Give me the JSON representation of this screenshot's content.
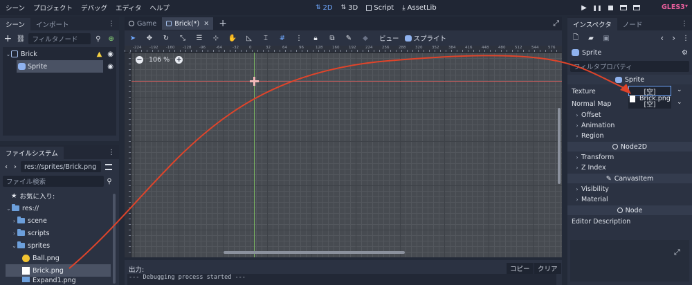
{
  "menubar": {
    "menus": [
      "シーン",
      "プロジェクト",
      "デバッグ",
      "エディタ",
      "ヘルプ"
    ],
    "workspaces": [
      {
        "label": "2D",
        "icon": "2d-icon",
        "active": true
      },
      {
        "label": "3D",
        "icon": "3d-icon",
        "active": false
      },
      {
        "label": "Script",
        "icon": "script-icon",
        "active": false
      },
      {
        "label": "AssetLib",
        "icon": "assetlib-icon",
        "active": false
      }
    ],
    "renderer": "GLES3"
  },
  "scene_dock": {
    "tabs": [
      "シーン",
      "インポート"
    ],
    "filter_placeholder": "フィルタノード",
    "nodes": [
      {
        "label": "Brick",
        "icon": "node2d-icon",
        "warning": true
      },
      {
        "label": "Sprite",
        "icon": "sprite-icon",
        "selected": true
      }
    ]
  },
  "filesystem": {
    "tab": "ファイルシステム",
    "path": "res://sprites/Brick.png",
    "search_placeholder": "ファイル検索",
    "favorites": "お気に入り:",
    "root": "res://",
    "folders": [
      "scene",
      "scripts",
      "sprites"
    ],
    "files": [
      {
        "label": "Ball.png",
        "selected": false
      },
      {
        "label": "Brick.png",
        "selected": true
      },
      {
        "label": "Expand1.png",
        "selected": false
      }
    ]
  },
  "editor_tabs": {
    "tabs": [
      {
        "label": "Game",
        "active": false
      },
      {
        "label": "Brick(*)",
        "active": true
      }
    ]
  },
  "canvas_toolbar": {
    "view_label": "ビュー",
    "sprite_label": "スプライト",
    "zoom": "106 %"
  },
  "ruler": {
    "labels": [
      "-224",
      "-192",
      "-160",
      "-128",
      "-96",
      "-64",
      "-32",
      "0",
      "32",
      "64",
      "96",
      "128",
      "160",
      "192",
      "224",
      "256",
      "288",
      "320",
      "352",
      "384",
      "416",
      "448",
      "480",
      "512",
      "544",
      "576"
    ]
  },
  "output": {
    "title": "出力:",
    "copy_label": "コピー",
    "clear_label": "クリア",
    "lines": [
      "--- Debugging process started ---"
    ]
  },
  "inspector": {
    "tabs": [
      "インスペクタ",
      "ノード"
    ],
    "node_name": "Sprite",
    "filter_placeholder": "フィルタプロパティ",
    "sprite_section": "Sprite",
    "texture_label": "Texture",
    "texture_value": "[空]",
    "normalmap_label": "Normal Map",
    "normalmap_value": "[空]",
    "drag_preview": "Brick.png",
    "sprite_groups": [
      "Offset",
      "Animation",
      "Region"
    ],
    "node2d_section": "Node2D",
    "node2d_groups": [
      "Transform",
      "Z Index"
    ],
    "canvasitem_section": "CanvasItem",
    "canvasitem_groups": [
      "Visibility",
      "Material"
    ],
    "node_section": "Node",
    "editor_description": "Editor Description"
  },
  "colors": {
    "accent": "#6fa8ff",
    "arrow": "#e0442a",
    "warning": "#f5d142",
    "renderer": "#e85e9c"
  }
}
